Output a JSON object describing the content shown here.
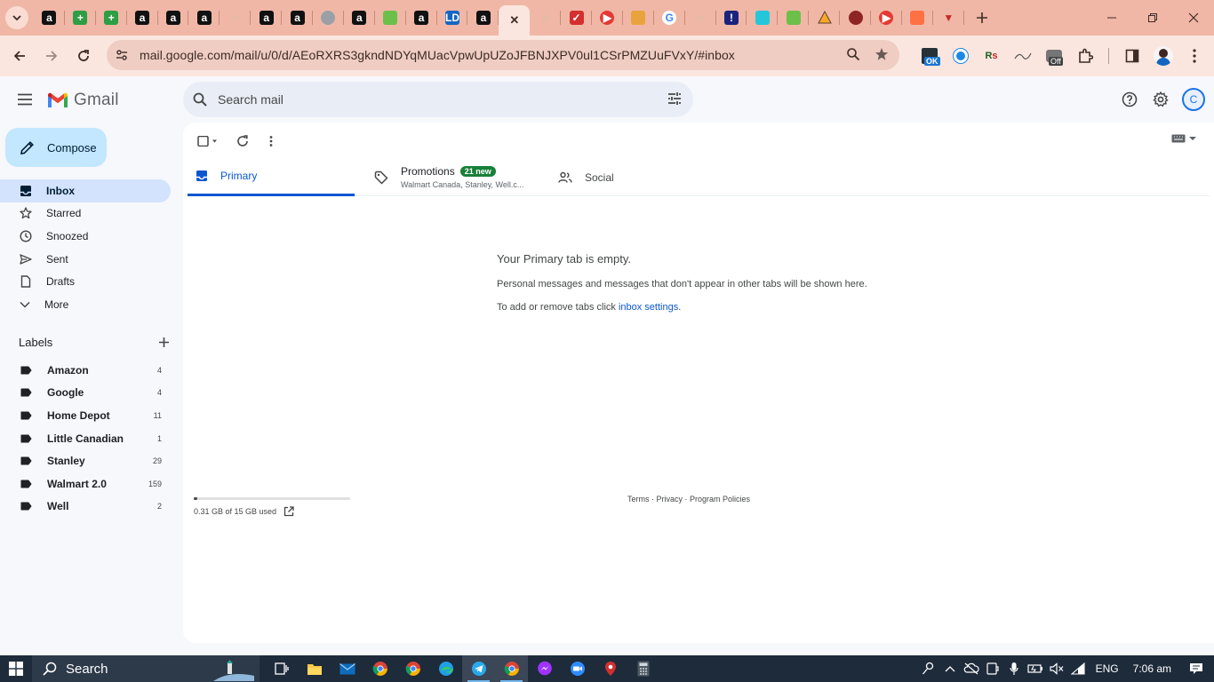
{
  "browser": {
    "url": "mail.google.com/mail/u/0/d/AEoRXRS3gkndNDYqMUacVpwUpUZoJFBNJXPV0ul1CSrPMZUuFVxY/#inbox",
    "tabs": [
      {
        "icon": "amazon-icon",
        "glyph": "a",
        "bg": "#111111"
      },
      {
        "icon": "plus-green-icon",
        "glyph": "+",
        "bg": "#2e9e44"
      },
      {
        "icon": "plus-green-icon",
        "glyph": "+",
        "bg": "#2e9e44"
      },
      {
        "icon": "amazon-icon",
        "glyph": "a",
        "bg": "#111111"
      },
      {
        "icon": "amazon-icon",
        "glyph": "a",
        "bg": "#111111"
      },
      {
        "icon": "amazon-icon",
        "glyph": "a",
        "bg": "#111111"
      },
      {
        "icon": "star-icon",
        "glyph": "★",
        "bg": "transparent"
      },
      {
        "icon": "amazon-icon",
        "glyph": "a",
        "bg": "#111111"
      },
      {
        "icon": "amazon-icon",
        "glyph": "a",
        "bg": "#111111"
      },
      {
        "icon": "globe-icon",
        "glyph": "",
        "bg": "#9aa0a6"
      },
      {
        "icon": "amazon-icon",
        "glyph": "a",
        "bg": "#111111"
      },
      {
        "icon": "shield-green-icon",
        "glyph": "",
        "bg": "#6cc04a"
      },
      {
        "icon": "amazon-icon",
        "glyph": "a",
        "bg": "#111111"
      },
      {
        "icon": "ld-icon",
        "glyph": "LD",
        "bg": "#1565c0"
      },
      {
        "icon": "amazon-icon",
        "glyph": "a",
        "bg": "#111111"
      },
      {
        "icon": "close-icon",
        "glyph": "✕",
        "bg": "transparent"
      },
      {
        "icon": "star-icon",
        "glyph": "★",
        "bg": "transparent"
      },
      {
        "icon": "red-check-icon",
        "glyph": "✓",
        "bg": "#d32f2f"
      },
      {
        "icon": "play-red-icon",
        "glyph": "▶",
        "bg": "#e53935"
      },
      {
        "icon": "taco-icon",
        "glyph": "",
        "bg": "#e8a33c"
      },
      {
        "icon": "google-icon",
        "glyph": "G",
        "bg": "#ffffff"
      },
      {
        "icon": "star-icon",
        "glyph": "★",
        "bg": "transparent"
      },
      {
        "icon": "exclamation-icon",
        "glyph": "!",
        "bg": "#1a237e"
      },
      {
        "icon": "frog-icon",
        "glyph": "",
        "bg": "#26c6da"
      },
      {
        "icon": "shield-green-icon",
        "glyph": "",
        "bg": "#6cc04a"
      },
      {
        "icon": "triangle-icon",
        "glyph": "",
        "bg": "transparent"
      },
      {
        "icon": "ball-icon",
        "glyph": "",
        "bg": "#8e2424"
      },
      {
        "icon": "play-red-icon",
        "glyph": "▶",
        "bg": "#e53935"
      },
      {
        "icon": "pencil-multi-icon",
        "glyph": "",
        "bg": "#ff7043"
      },
      {
        "icon": "funnel-icon",
        "glyph": "▼",
        "bg": "transparent"
      }
    ],
    "extension_badges": {
      "ok": "OK",
      "off": "Off"
    }
  },
  "gmail": {
    "logo_text": "Gmail",
    "search_placeholder": "Search mail",
    "avatar_initial": "C",
    "compose_label": "Compose",
    "nav": [
      {
        "label": "Inbox",
        "icon": "inbox-icon",
        "active": true
      },
      {
        "label": "Starred",
        "icon": "star-icon"
      },
      {
        "label": "Snoozed",
        "icon": "clock-icon"
      },
      {
        "label": "Sent",
        "icon": "send-icon"
      },
      {
        "label": "Drafts",
        "icon": "draft-icon"
      },
      {
        "label": "More",
        "icon": "chevron-down-icon"
      }
    ],
    "labels_title": "Labels",
    "labels": [
      {
        "name": "Amazon",
        "count": "4"
      },
      {
        "name": "Google",
        "count": "4"
      },
      {
        "name": "Home Depot",
        "count": "11"
      },
      {
        "name": "Little Canadian",
        "count": "1"
      },
      {
        "name": "Stanley",
        "count": "29"
      },
      {
        "name": "Walmart 2.0",
        "count": "159"
      },
      {
        "name": "Well",
        "count": "2"
      }
    ],
    "tabs": {
      "primary": "Primary",
      "promotions": "Promotions",
      "promotions_badge": "21 new",
      "promotions_senders": "Walmart Canada, Stanley, Well.c...",
      "social": "Social"
    },
    "empty": {
      "heading": "Your Primary tab is empty.",
      "line1": "Personal messages and messages that don't appear in other tabs will be shown here.",
      "line2_prefix": "To add or remove tabs click ",
      "line2_link": "inbox settings",
      "line2_suffix": "."
    },
    "storage": {
      "text": "0.31 GB of 15 GB used",
      "used_fraction": 0.021
    },
    "footer": {
      "terms": "Terms",
      "sep": " · ",
      "privacy": "Privacy",
      "program": "Program Policies"
    },
    "colors": {
      "accent": "#0b57d0",
      "compose": "#c2e7ff",
      "active_nav": "#d3e3fd",
      "badge": "#188038"
    }
  },
  "taskbar": {
    "search_label": "Search",
    "language": "ENG",
    "time": "7:06 am"
  }
}
